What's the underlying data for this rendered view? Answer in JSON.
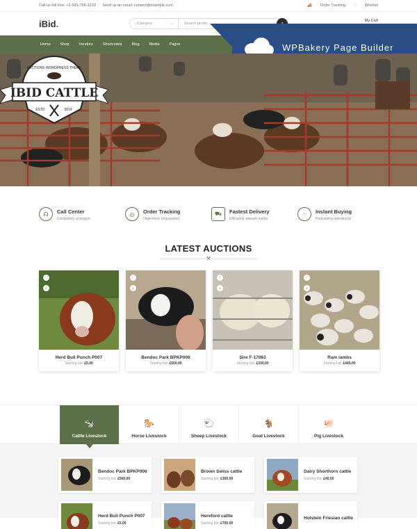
{
  "topbar": {
    "phone": "Call us toll free: +1-541-754-3210",
    "email": "Send us an email: contact@example.com",
    "order_tracking": "Order Tracking",
    "wishlist": "Wishlist"
  },
  "header": {
    "logo": "iBid",
    "logo_dot": ".",
    "category": "Category",
    "search_placeholder": "Search produ",
    "cart": "My Cart"
  },
  "nav": [
    "Home",
    "Shop",
    "Vendors",
    "Shortcodes",
    "Blog",
    "Media",
    "Pages"
  ],
  "wpbakery": {
    "label": "WPBakery Page Builder"
  },
  "hero": {
    "badge_top": "AUCTIONS WORDPRESS THEME",
    "badge_title": "IBID CATTLE",
    "est": "ESTD",
    "year": "2019"
  },
  "features": [
    {
      "icon": "headset-icon",
      "title": "Call Center",
      "sub": "Completely synergize"
    },
    {
      "icon": "tracking-icon",
      "title": "Order Tracking",
      "sub": "Objectively empowered"
    },
    {
      "icon": "truck-icon",
      "title": "Fastest Delivery",
      "sub": "Efficiently unleash media"
    },
    {
      "icon": "hand-icon",
      "title": "Instant Buying",
      "sub": "Podcasting operational"
    }
  ],
  "auctions": {
    "title": "LATEST AUCTIONS",
    "bid_label": "Starting bid:",
    "items": [
      {
        "name": "Herd Bull Punch P007",
        "price": "£5.00"
      },
      {
        "name": "Bendoc Park BPKP006",
        "price": "£500.00"
      },
      {
        "name": "Sire F-17063",
        "price": "£330.00"
      },
      {
        "name": "Ram lambs",
        "price": "£445.00"
      }
    ]
  },
  "tabs": [
    {
      "label": "Cattle Livestock",
      "icon": "cow-icon"
    },
    {
      "label": "Horse Livestock",
      "icon": "horse-icon"
    },
    {
      "label": "Sheep Livestock",
      "icon": "sheep-icon"
    },
    {
      "label": "Goat Livestock",
      "icon": "goat-icon"
    },
    {
      "label": "Pig Livestock",
      "icon": "pig-icon"
    }
  ],
  "products": {
    "bid_label": "Starting bid:",
    "row1": [
      {
        "name": "Bendoc Park BPKP006",
        "price": "£500.00"
      },
      {
        "name": "Brown Swiss cattle",
        "price": "£300.00"
      },
      {
        "name": "Dairy Shorthorn cattle",
        "price": "£40.00"
      }
    ],
    "row2": [
      {
        "name": "Herd Bull Punch P007",
        "price": "£5.00"
      },
      {
        "name": "Hereford cattle",
        "price": "£700.00"
      },
      {
        "name": "Holstein Friesian cattle",
        "price": ""
      }
    ]
  }
}
